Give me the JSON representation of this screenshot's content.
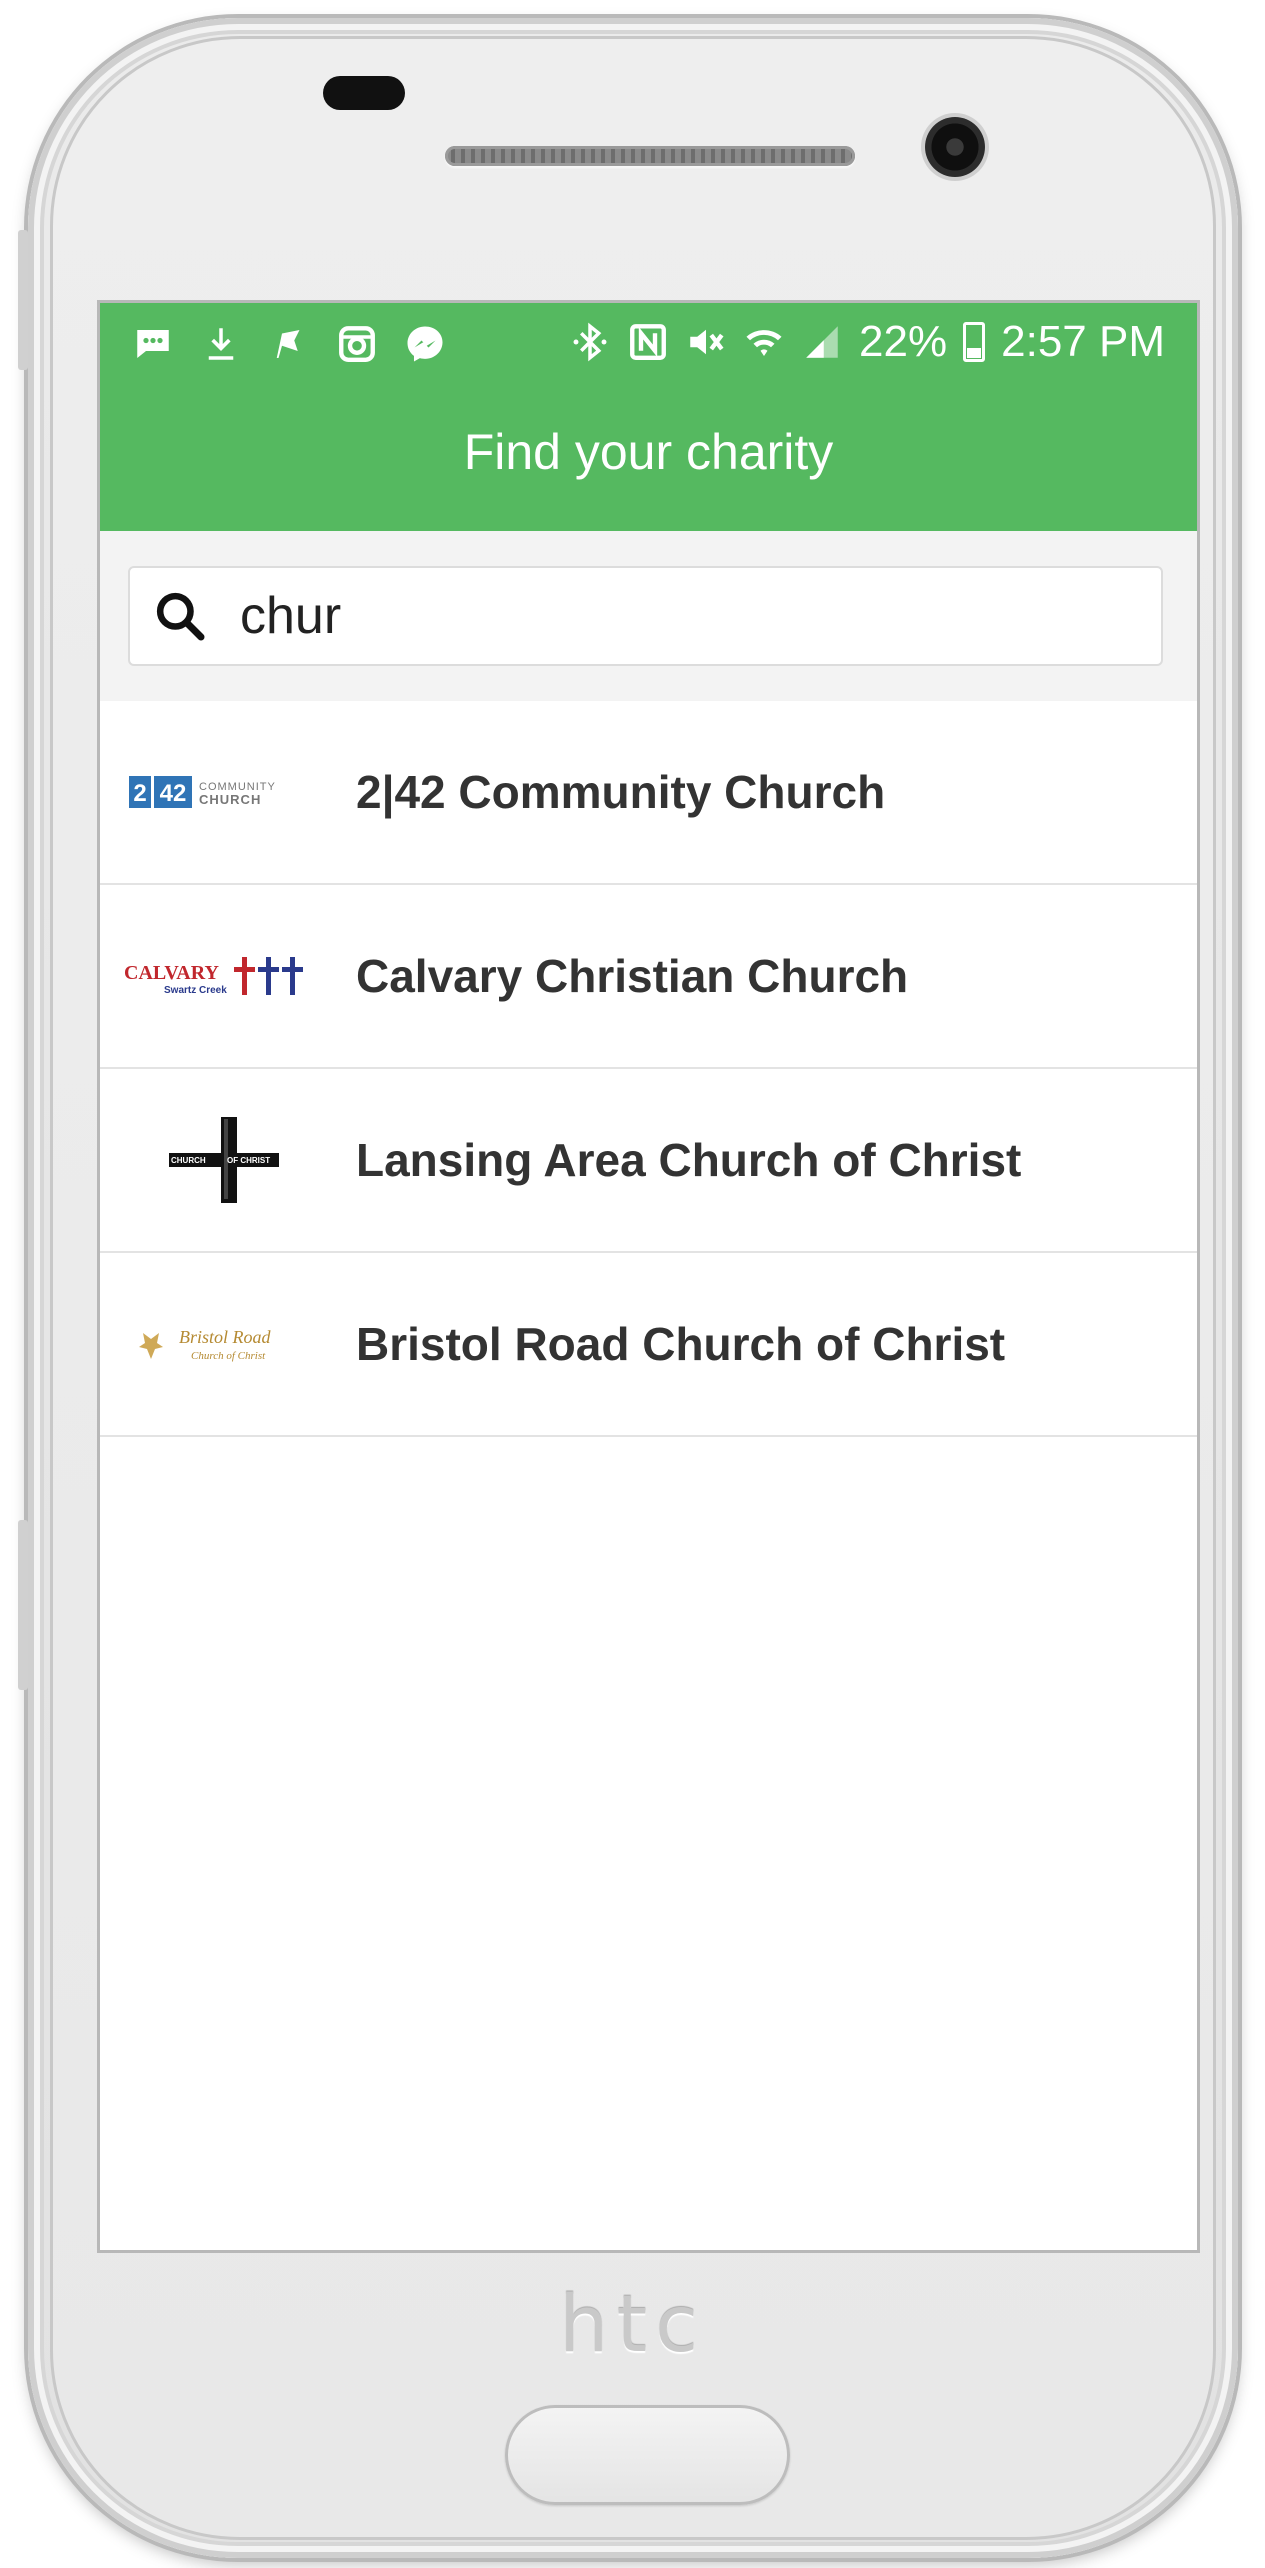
{
  "device": {
    "brand": "htc"
  },
  "status_bar": {
    "left_icons": [
      "message-icon",
      "download-icon",
      "flag-icon",
      "instagram-icon",
      "messenger-icon"
    ],
    "right_icons": [
      "bluetooth-icon",
      "nfc-icon",
      "mute-icon",
      "wifi-icon",
      "signal-icon"
    ],
    "battery": "22%",
    "time": "2:57 PM"
  },
  "appbar": {
    "title": "Find your charity",
    "color": "#55b960"
  },
  "search": {
    "value": "chur",
    "icon": "search-icon"
  },
  "results": [
    {
      "name": "2|42 Community Church",
      "logo": "242-community-church-logo",
      "logo_text_a": "2",
      "logo_text_b": "42",
      "logo_text_c": "COMMUNITY",
      "logo_text_d": "CHURCH"
    },
    {
      "name": "Calvary Christian Church",
      "logo": "calvary-logo",
      "logo_text_a": "CALVARY",
      "logo_text_b": "Swartz Creek"
    },
    {
      "name": "Lansing Area Church of Christ",
      "logo": "lansing-church-logo",
      "logo_text_a": "CHURCH",
      "logo_text_b": "OF CHRIST"
    },
    {
      "name": "Bristol Road Church of Christ",
      "logo": "bristol-road-logo",
      "logo_text_a": "Bristol Road",
      "logo_text_b": "Church of Christ"
    }
  ]
}
